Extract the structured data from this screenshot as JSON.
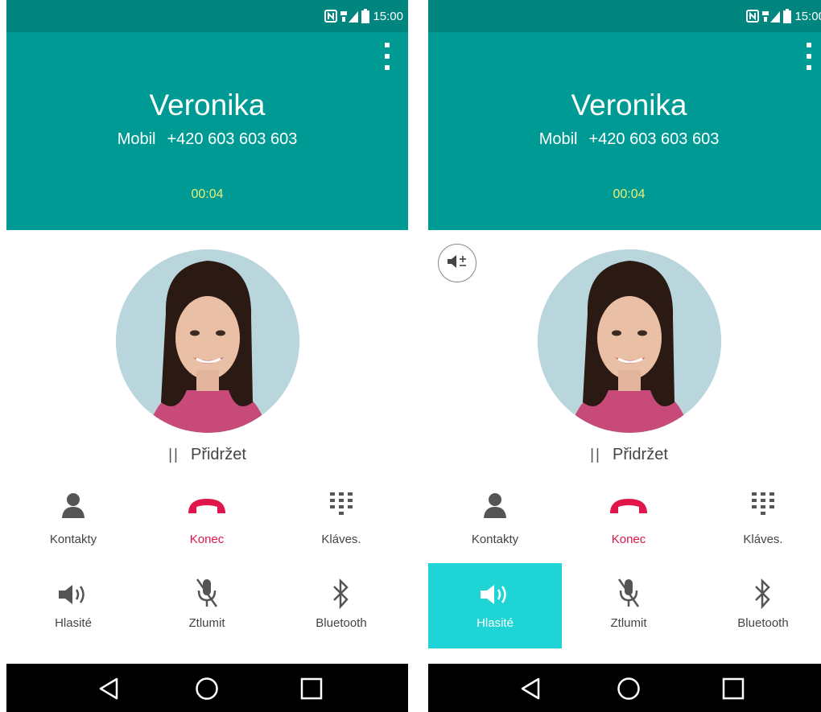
{
  "status": {
    "time": "15:00"
  },
  "call": {
    "name": "Veronika",
    "line_label": "Mobil",
    "number": "+420 603 603 603",
    "duration": "00:04"
  },
  "hold_label": "Přidržet",
  "buttons": {
    "contacts": "Kontakty",
    "end": "Konec",
    "keypad": "Kláves.",
    "speaker": "Hlasité",
    "mute": "Ztlumit",
    "bluetooth": "Bluetooth"
  },
  "colors": {
    "header": "#009a94",
    "statusbar": "#00857f",
    "timer": "#e8f07a",
    "end_call": "#e0154a",
    "speaker_active": "#1fd4d4"
  },
  "icons": [
    "nfc-icon",
    "signal-icon",
    "battery-icon",
    "menu-icon",
    "contact-icon",
    "end-call-icon",
    "keypad-icon",
    "speaker-icon",
    "mute-icon",
    "bluetooth-icon",
    "back-icon",
    "home-icon",
    "recents-icon",
    "volume-adjust-icon"
  ],
  "screens": [
    {
      "id": "before",
      "speaker_on": false
    },
    {
      "id": "after",
      "speaker_on": true
    }
  ]
}
